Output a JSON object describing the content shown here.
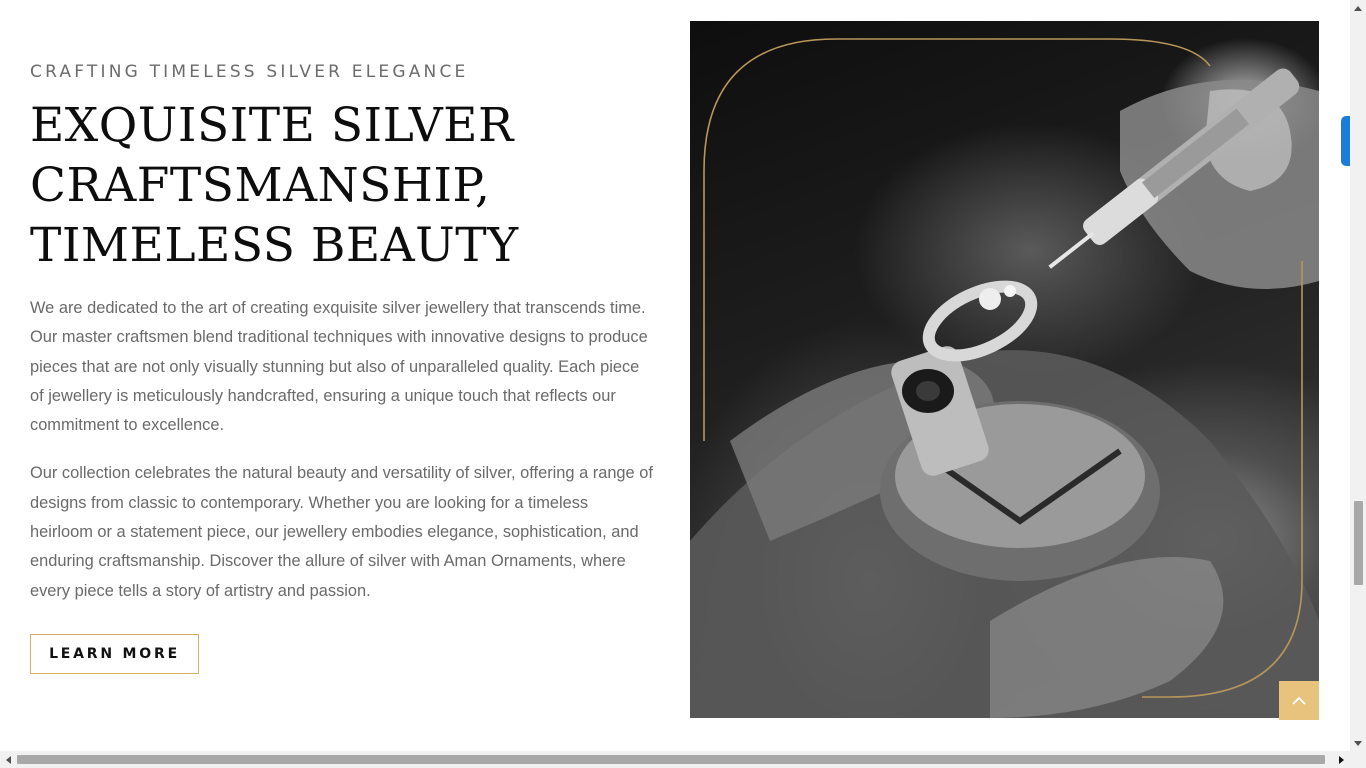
{
  "about": {
    "eyebrow": "CRAFTING TIMELESS SILVER ELEGANCE",
    "headline": "EXQUISITE SILVER\nCRAFTSMANSHIP,\nTIMELESS BEAUTY",
    "paragraph_1": "We are dedicated to the art of creating exquisite silver jewellery that transcends time. Our master craftsmen blend traditional techniques with innovative designs to produce pieces that are not only visually stunning but also of unparalleled quality. Each piece of jewellery is meticulously handcrafted, ensuring a unique touch that reflects our commitment to excellence.",
    "paragraph_2": "Our collection celebrates the natural beauty and versatility of silver, offering a range of designs from classic to contemporary. Whether you are looking for a timeless heirloom or a statement piece, our jewellery embodies elegance, sophistication, and enduring craftsmanship. Discover the allure of silver with Aman Ornaments, where every piece tells a story of artistry and passion.",
    "button_label": "LEARN MORE"
  },
  "image": {
    "icon": "craftsman-ring-photo-icon",
    "frame_color": "#b8965a"
  },
  "scroll_top": {
    "icon": "chevron-up-icon",
    "color": "#e8c37e"
  },
  "colors": {
    "accent": "#d9b06a",
    "side_tab": "#1a7ed9"
  }
}
